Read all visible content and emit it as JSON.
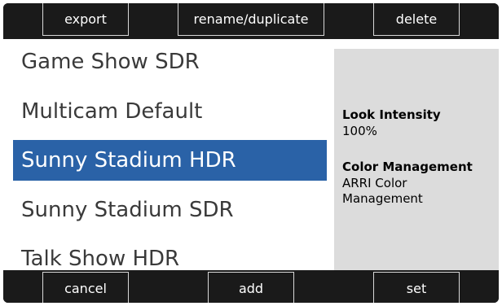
{
  "top_bar": {
    "export_label": "export",
    "rename_label": "rename/duplicate",
    "delete_label": "delete"
  },
  "looks_list": {
    "items": [
      {
        "label": "Game Show SDR",
        "selected": false
      },
      {
        "label": "Multicam Default",
        "selected": false
      },
      {
        "label": "Sunny Stadium HDR",
        "selected": true
      },
      {
        "label": "Sunny Stadium SDR",
        "selected": false
      },
      {
        "label": "Talk Show HDR",
        "selected": false
      }
    ]
  },
  "info_panel": {
    "look_intensity_label": "Look Intensity",
    "look_intensity_value": "100%",
    "color_management_label": "Color Management",
    "color_management_value": "ARRI Color Management"
  },
  "bottom_bar": {
    "cancel_label": "cancel",
    "add_label": "add",
    "set_label": "set"
  },
  "colors": {
    "selection": "#2a62a7",
    "bars": "#1a1a1a",
    "info_panel": "#dcdcdc"
  }
}
